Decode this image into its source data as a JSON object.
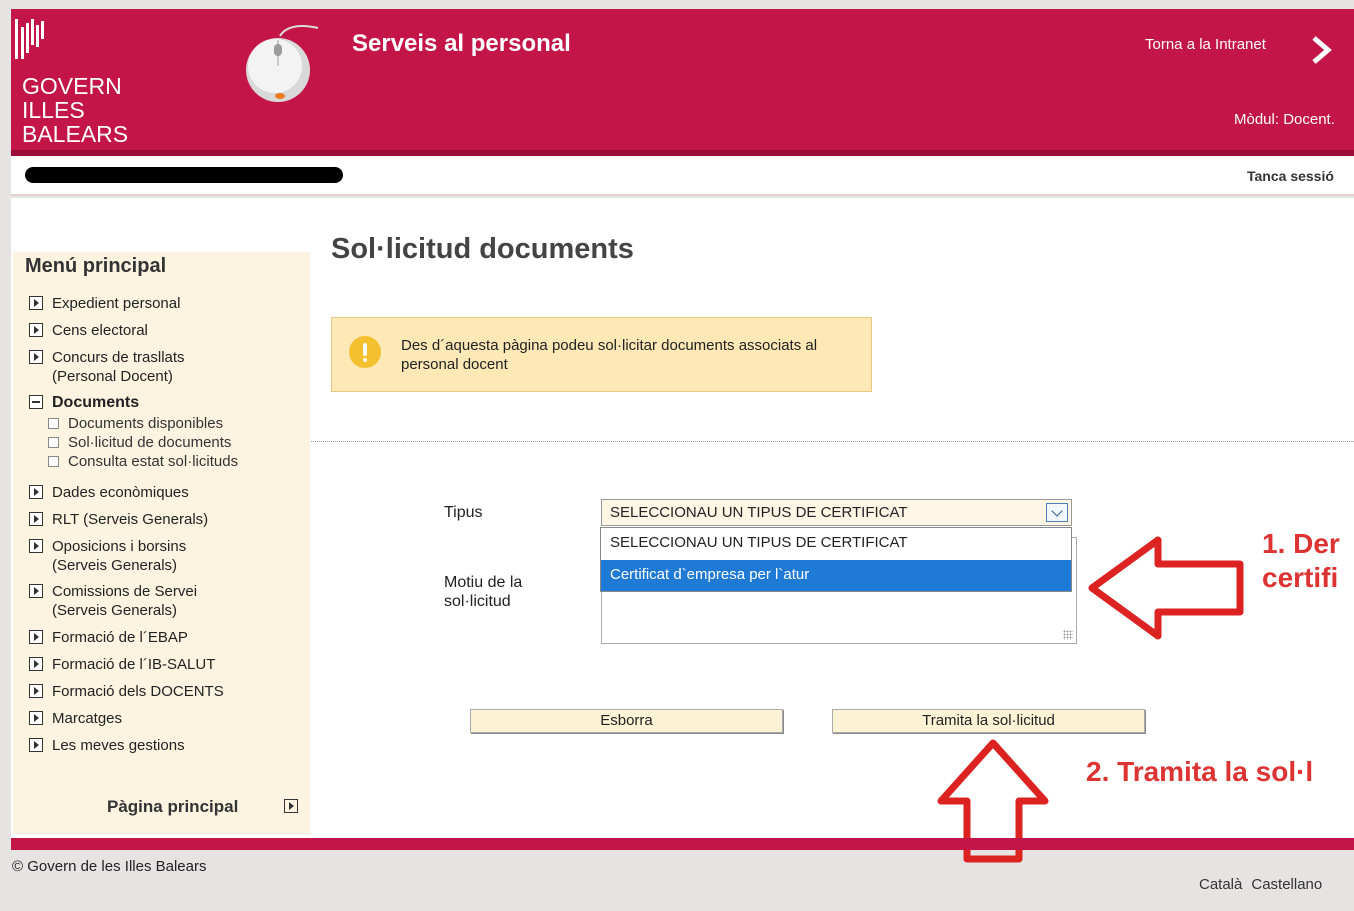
{
  "header": {
    "logo_lines": [
      "GOVERN",
      "ILLES",
      "BALEARS"
    ],
    "app_title": "Serveis al personal",
    "back_link": "Torna a la Intranet",
    "module": "Mòdul: Docent."
  },
  "userbar": {
    "logout": "Tanca sessió"
  },
  "sidebar": {
    "title": "Menú principal",
    "items": [
      {
        "label": "Expedient personal"
      },
      {
        "label": "Cens electoral"
      },
      {
        "label": "Concurs de trasllats",
        "label2": "(Personal Docent)"
      },
      {
        "label": "Documents"
      },
      {
        "label": "Dades econòmiques"
      },
      {
        "label": "RLT (Serveis Generals)"
      },
      {
        "label": "Oposicions i borsins",
        "label2": "(Serveis Generals)"
      },
      {
        "label": "Comissions de Servei",
        "label2": "(Serveis Generals)"
      },
      {
        "label": "Formació de l´EBAP"
      },
      {
        "label": "Formació de l´IB-SALUT"
      },
      {
        "label": "Formació dels DOCENTS"
      },
      {
        "label": "Marcatges"
      },
      {
        "label": "Les meves gestions"
      }
    ],
    "documents_sub": [
      "Documents disponibles",
      "Sol·licitud de documents",
      "Consulta estat sol·licituds"
    ],
    "home_link": "Pàgina principal"
  },
  "main": {
    "title": "Sol·licitud documents",
    "info": "Des d´aquesta pàgina podeu sol·licitar documents associats al personal docent",
    "form": {
      "type_label": "Tipus",
      "type_value": "SELECCIONAU UN TIPUS DE CERTIFICAT",
      "type_options": [
        "SELECCIONAU UN TIPUS DE CERTIFICAT",
        "Certificat d`empresa per l`atur"
      ],
      "reason_label_1": "Motiu de la",
      "reason_label_2": "sol·licitud"
    },
    "buttons": {
      "clear": "Esborra",
      "submit": "Tramita la sol·licitud"
    },
    "annotations": {
      "step1_line1": "1. Der",
      "step1_line2": "certifi",
      "step2": "2. Tramita la sol·l"
    }
  },
  "footer": {
    "copyright": "© Govern de les Illes Balears",
    "languages": [
      "Català",
      "Castellano"
    ]
  },
  "colors": {
    "brand": "#c41548",
    "sidebar_bg": "#fcf4e0",
    "info_bg": "#fde8b6",
    "selection": "#1f7ad6",
    "annotation": "#dd3333"
  }
}
